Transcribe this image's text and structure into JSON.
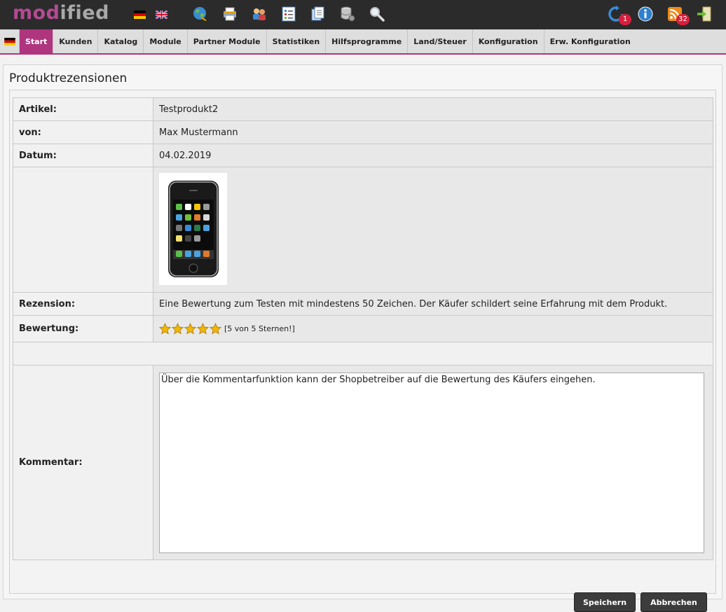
{
  "app": {
    "logo_prefix": "mod",
    "logo_suffix": "ified"
  },
  "topbar": {
    "languages": [
      "de-flag-icon",
      "uk-flag-icon"
    ],
    "icons": [
      "globe-icon",
      "printer-icon",
      "customers-icon",
      "orders-icon",
      "documents-icon",
      "database-icon",
      "search-icon"
    ],
    "updates_badge": "1",
    "rss_badge": "32"
  },
  "nav": {
    "items": [
      "Start",
      "Kunden",
      "Katalog",
      "Module",
      "Partner Module",
      "Statistiken",
      "Hilfsprogramme",
      "Land/Steuer",
      "Konfiguration",
      "Erw. Konfiguration"
    ],
    "active": "Start"
  },
  "page": {
    "title": "Produktrezensionen"
  },
  "review": {
    "article_label": "Artikel:",
    "article_value": "Testprodukt2",
    "from_label": "von:",
    "from_value": "Max Mustermann",
    "date_label": "Datum:",
    "date_value": "04.02.2019",
    "review_label": "Rezension:",
    "review_value": "Eine Bewertung zum Testen mit mindestens 50 Zeichen. Der Käufer schildert seine Erfahrung mit dem Produkt.",
    "rating_label": "Bewertung:",
    "rating_value": 5,
    "rating_max": 5,
    "rating_text": "[5 von 5 Sternen!]",
    "comment_label": "Kommentar:",
    "comment_value": "Über die Kommentarfunktion kann der Shopbetreiber auf die Bewertung des Käufers eingehen."
  },
  "buttons": {
    "save": "Speichern",
    "cancel": "Abbrechen"
  },
  "colors": {
    "accent": "#b0357f",
    "topbar": "#2b2b2b",
    "badge": "#d81e3c",
    "star": "#f2b705"
  }
}
